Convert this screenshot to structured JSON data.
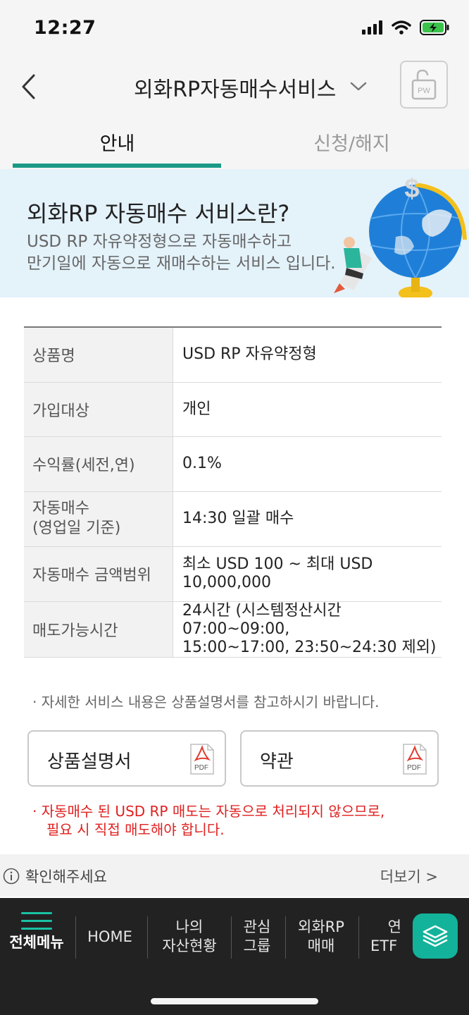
{
  "status_bar": {
    "time": "12:27"
  },
  "header": {
    "title": "외화RP자동매수서비스",
    "pw_label": "PW"
  },
  "tabs": [
    {
      "label": "안내",
      "active": true
    },
    {
      "label": "신청/해지",
      "active": false
    }
  ],
  "banner": {
    "title": "외화RP 자동매수 서비스란?",
    "desc_line1": "USD RP 자유약정형으로 자동매수하고",
    "desc_line2": "만기일에 자동으로 재매수하는 서비스 입니다."
  },
  "table": {
    "rows": [
      {
        "label": "상품명",
        "value": "USD RP 자유약정형"
      },
      {
        "label": "가입대상",
        "value": "개인"
      },
      {
        "label": "수익률(세전,연)",
        "value": "0.1%"
      },
      {
        "label_line1": "자동매수",
        "label_line2": "(영업일 기준)",
        "value": "14:30 일괄 매수"
      },
      {
        "label": "자동매수 금액범위",
        "value": "최소 USD 100 ~ 최대 USD 10,000,000"
      },
      {
        "label": "매도가능시간",
        "value_line1": "24시간 (시스템정산시간 07:00~09:00,",
        "value_line2": "15:00~17:00, 23:50~24:30 제외)"
      }
    ]
  },
  "note": "· 자세한 서비스 내용은 상품설명서를 참고하시기 바랍니다.",
  "doc_buttons": [
    {
      "label": "상품설명서",
      "icon": "pdf-icon",
      "icon_text": "PDF"
    },
    {
      "label": "약관",
      "icon": "pdf-icon",
      "icon_text": "PDF"
    }
  ],
  "warning": {
    "line1": "· 자동매수 된 USD RP 매도는 자동으로 처리되지 않으므로,",
    "line2": "필요 시 직접 매도해야 합니다."
  },
  "footer": {
    "confirm": "확인해주세요",
    "more": "더보기 >"
  },
  "bottom_nav": {
    "menu": "전체메뉴",
    "home": "HOME",
    "assets_line1": "나의",
    "assets_line2": "자산현황",
    "watch_line1": "관심",
    "watch_line2": "그룹",
    "rp_line1": "외화RP",
    "rp_line2": "매매",
    "etf_line1": "연",
    "etf_line2": "ETF"
  },
  "colors": {
    "accent": "#1a9a86",
    "warning": "#e02020",
    "banner_bg": "#e4f2fa",
    "nav_bg": "#222222",
    "fab": "#12b39a"
  }
}
